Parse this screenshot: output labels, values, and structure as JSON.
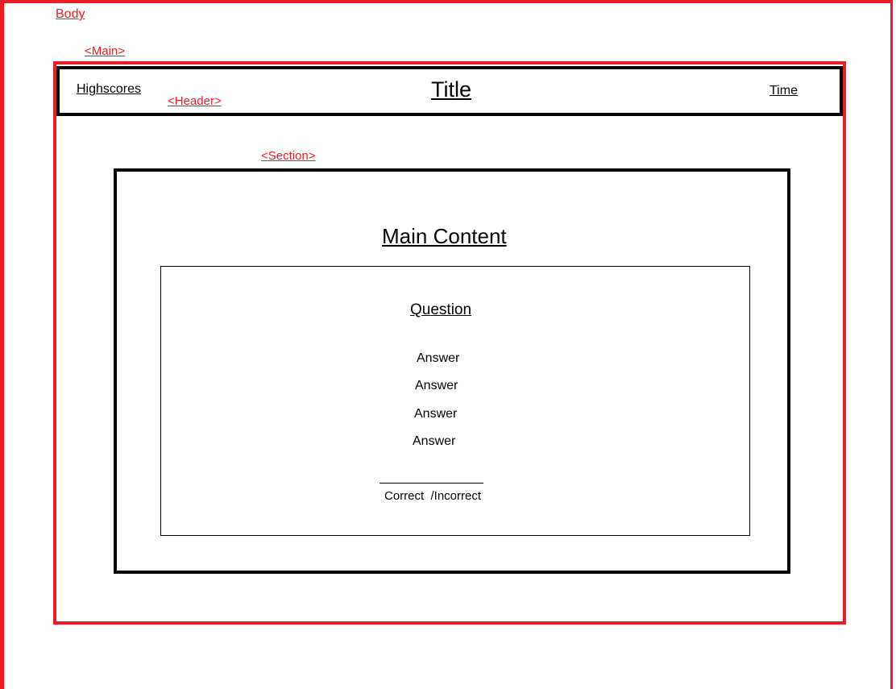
{
  "labels": {
    "body": "Body",
    "main": "<Main>",
    "header": "<Header>",
    "section": "<Section>"
  },
  "header": {
    "highscores": "Highscores",
    "title": "Title",
    "time": "Time"
  },
  "section": {
    "heading": "Main Content"
  },
  "quiz": {
    "question": "Question",
    "answers": [
      "Answer",
      "Answer",
      "Answer",
      "Answer"
    ],
    "feedback": "Correct  /Incorrect"
  },
  "colors": {
    "annotation": "#ec1c24",
    "outline": "#000000",
    "background": "#ffffff"
  }
}
